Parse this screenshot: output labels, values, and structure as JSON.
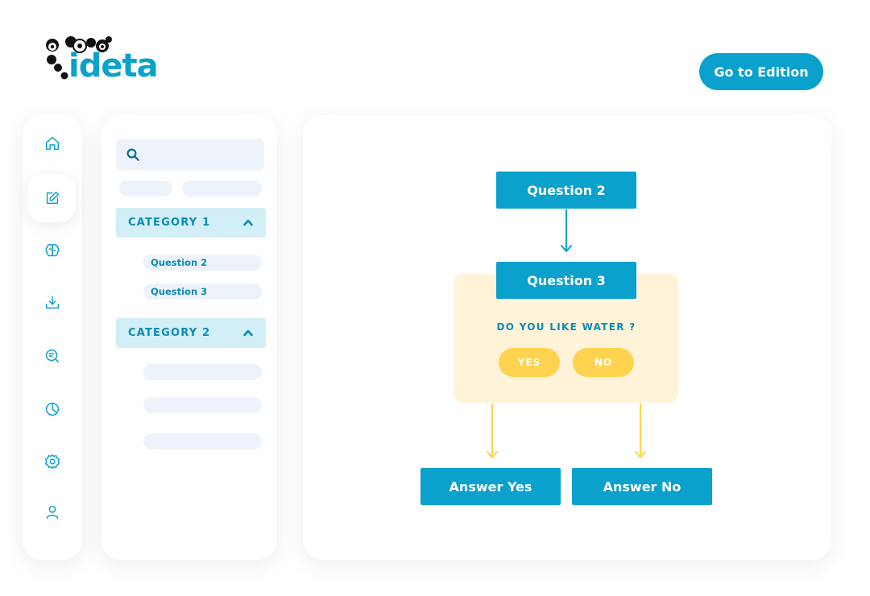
{
  "logo": {
    "text": "ideta",
    "mascot_icon": "panda-mascot-icon"
  },
  "header": {
    "edition_button": "Go to Edition"
  },
  "rail": {
    "icons": [
      "home-icon",
      "edit-icon",
      "brain-icon",
      "download-icon",
      "chat-search-icon",
      "pie-chart-icon",
      "settings-icon",
      "user-icon"
    ],
    "active": "edit-icon"
  },
  "tree": {
    "search_icon": "search-icon",
    "categories": [
      {
        "label": "CATEGORY 1",
        "expanded": true,
        "items": [
          "Question 2",
          "Question 3"
        ]
      },
      {
        "label": "CATEGORY 2",
        "expanded": true,
        "items": []
      }
    ]
  },
  "flow": {
    "question2": "Question 2",
    "question3": "Question 3",
    "prompt": "DO YOU LIKE WATER ?",
    "yes": "YES",
    "no": "NO",
    "answer_yes": "Answer Yes",
    "answer_no": "Answer No"
  },
  "colors": {
    "accent": "#0aa1cc",
    "card": "#fff3d9",
    "choice": "#ffd24f",
    "category_bg": "#d2eef6",
    "placeholder": "#eef3fb"
  }
}
